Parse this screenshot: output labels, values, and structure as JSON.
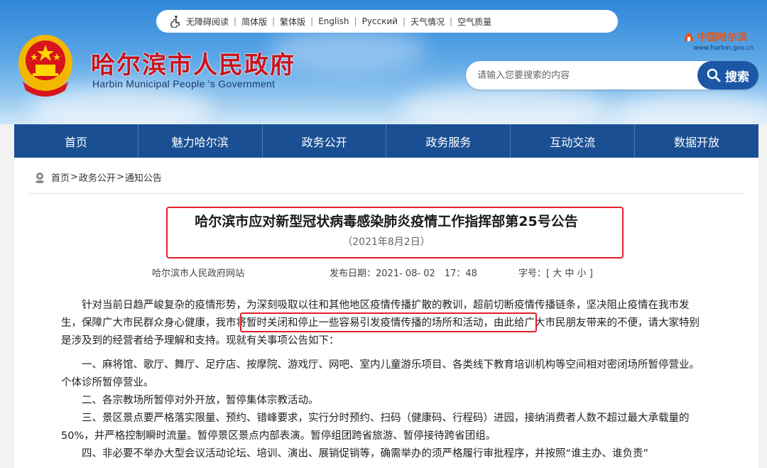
{
  "toolbar": {
    "links": [
      "无障碍阅读",
      "简体版",
      "繁体版",
      "English",
      "Русский",
      "天气情况",
      "空气质量"
    ]
  },
  "site": {
    "title": "哈尔滨市人民政府",
    "subtitle": "Harbin Municipal People 's Government",
    "brand_name": "中国哈尔滨",
    "brand_url": "www.harbin.gov.cn"
  },
  "search": {
    "placeholder": "请输入您要搜索的内容",
    "value": "",
    "button_label": "搜索"
  },
  "nav": {
    "items": [
      "首页",
      "魅力哈尔滨",
      "政务公开",
      "政务服务",
      "互动交流",
      "数据开放"
    ]
  },
  "breadcrumb": {
    "items": [
      "首页",
      "政务公开",
      "通知公告"
    ],
    "separator": ">"
  },
  "article": {
    "title": "哈尔滨市应对新型冠状病毒感染肺炎疫情工作指挥部第25号公告",
    "date": "（2021年8月2日）",
    "source": "哈尔滨市人民政府网站",
    "publish_label": "发布日期：",
    "publish_time": "2021- 08- 02　17：48",
    "font_label": "字号：[",
    "font_sizes": [
      "大",
      "中",
      "小"
    ],
    "font_close": "]",
    "paragraphs": {
      "intro_a": "针对当前日趋严峻复杂的疫情形势，为深刻吸取以往和其他地区疫情传播扩散的教训，超前切断疫情传播链条，坚决阻止疫情在我市发生，保障广大市民群众身心健康，",
      "intro_b": "我市将暂时关闭和停止一些容易引发疫情传播的场所和活动，",
      "intro_c": "由此给广大市民朋友带来的不便，请大家特别是涉及到的经营者给予理解和支持。现就有关事项公告如下：",
      "p1": "一、麻将馆、歌厅、舞厅、足疗店、按摩院、游戏厅、网吧、室内儿童游乐项目、各类线下教育培训机构等空间相对密闭场所暂停营业。个体诊所暂停营业。",
      "p2": "二、各宗教场所暂停对外开放，暂停集体宗教活动。",
      "p3": "三、景区景点要严格落实限量、预约、错峰要求，实行分时预约、扫码（健康码、行程码）进园，接纳消费者人数不超过最大承载量的50%，并严格控制瞬时流量。暂停景区景点内部表演。暂停组团跨省旅游、暂停接待跨省团组。",
      "p4": "四、非必要不举办大型会议活动论坛、培训、演出、展销促销等，确需举办的须严格履行审批程序，并按照“谁主办、谁负责”"
    }
  },
  "colors": {
    "nav_bg": "#1a4f93",
    "title_red": "#c8141c",
    "highlight_red": "#e0202a",
    "search_btn": "#1b57a6"
  }
}
